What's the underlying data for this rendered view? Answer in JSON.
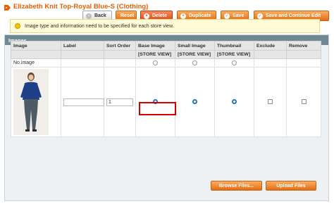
{
  "header": {
    "title": "Elizabeth Knit Top-Royal Blue-S (Clothing)"
  },
  "toolbar": {
    "back": "Back",
    "reset": "Reset",
    "delete": "Delete",
    "duplicate": "Duplicate",
    "save": "Save",
    "save_continue": "Save and Continue Edit"
  },
  "section": {
    "title": "Images",
    "notice": "Image type and information need to be specified for each store view."
  },
  "table": {
    "columns": [
      "Image",
      "Label",
      "Sort Order",
      "Base Image",
      "Small Image",
      "Thumbnail",
      "Exclude",
      "Remove"
    ],
    "scope_label": "[STORE VIEW]",
    "no_image_row": {
      "label": "No image"
    },
    "image_row": {
      "label_value": "",
      "sort_order": "1",
      "base_image_selected": true,
      "small_image_selected": true,
      "thumbnail_selected": true,
      "exclude_checked": false,
      "remove_checked": false
    }
  },
  "uploader": {
    "browse": "Browse Files...",
    "upload": "Upload Files"
  },
  "colors": {
    "accent_orange": "#eb5e00",
    "section_header": "#6f8992",
    "highlight_red": "#d30000"
  }
}
